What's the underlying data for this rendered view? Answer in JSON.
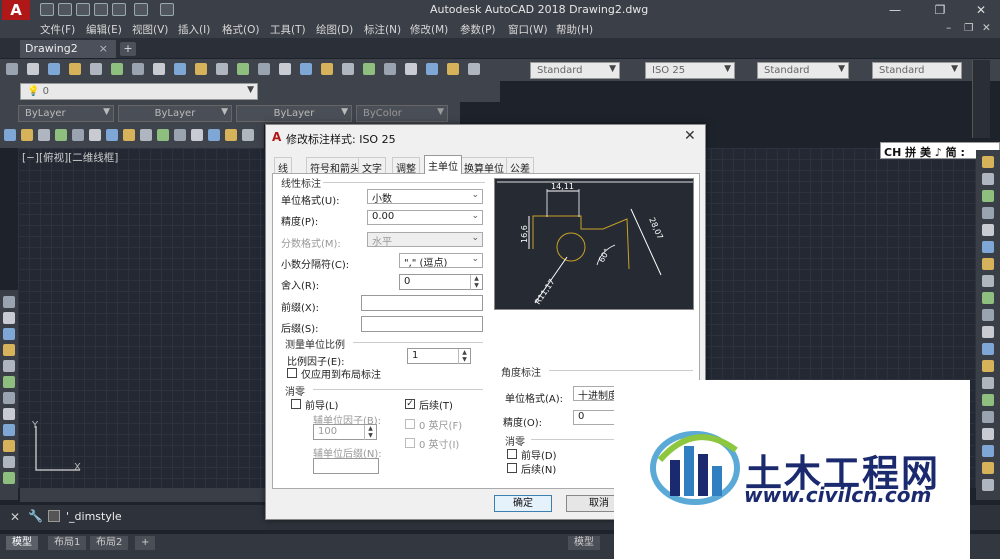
{
  "app": {
    "title": "Autodesk AutoCAD 2018    Drawing2.dwg",
    "logo": "A"
  },
  "menu": [
    "文件(F)",
    "编辑(E)",
    "视图(V)",
    "插入(I)",
    "格式(O)",
    "工具(T)",
    "绘图(D)",
    "标注(N)",
    "修改(M)",
    "参数(P)",
    "窗口(W)",
    "帮助(H)"
  ],
  "tabs": {
    "document": "Drawing2",
    "close": "×",
    "new": "+"
  },
  "toolbar": {
    "text_style": "Standard",
    "dim_style": "ISO 25",
    "table_style": "Standard",
    "multileader_style": "Standard",
    "layer": "0",
    "color": "ByLayer",
    "linetype": "ByLayer",
    "lineweight": "ByLayer",
    "plotstyle": "ByColor"
  },
  "viewport": {
    "label": "[−][俯视][二维线框]"
  },
  "ime": {
    "text": "CH 拼 美 ♪ 简 :"
  },
  "command": {
    "prompt": "'_dimstyle"
  },
  "status": {
    "model_tab": "模型",
    "layout1": "布局1",
    "layout2": "布局2",
    "model_button": "模型"
  },
  "dialog": {
    "title": "修改标注样式: ISO 25",
    "tabs": [
      "线",
      "符号和箭头",
      "文字",
      "调整",
      "主单位",
      "换算单位",
      "公差"
    ],
    "active_tab": "主单位",
    "linear": {
      "group": "线性标注",
      "unit_format_label": "单位格式(U):",
      "unit_format": "小数",
      "precision_label": "精度(P):",
      "precision": "0.00",
      "fraction_label": "分数格式(M):",
      "fraction": "水平",
      "decimal_sep_label": "小数分隔符(C):",
      "decimal_sep": "\",\" (逗点)",
      "round_label": "舍入(R):",
      "round": "0",
      "prefix_label": "前缀(X):",
      "suffix_label": "后缀(S):"
    },
    "scale": {
      "group": "测量单位比例",
      "factor_label": "比例因子(E):",
      "factor": "1",
      "layout_only": "仅应用到布局标注"
    },
    "zero": {
      "group": "消零",
      "leading": "前导(L)",
      "trailing": "后续(T)",
      "sub_factor_label": "辅单位因子(B):",
      "sub_factor": "100",
      "feet": "0 英尺(F)",
      "inches": "0 英寸(I)",
      "sub_suffix_label": "辅单位后缀(N):"
    },
    "angular": {
      "group": "角度标注",
      "unit_format_label": "单位格式(A):",
      "unit_format": "十进制度数",
      "precision_label": "精度(O):",
      "precision": "0",
      "zero_group": "消零",
      "leading": "前导(D)",
      "trailing": "后续(N)"
    },
    "preview": {
      "d1": "14,11",
      "d2": "16,6",
      "d3": "28,07",
      "angle": "60°",
      "radius": "R11,17"
    },
    "ok": "确定",
    "cancel": "取消"
  },
  "watermark": {
    "title": "土木工程网",
    "url": "www.civilcn.com"
  }
}
